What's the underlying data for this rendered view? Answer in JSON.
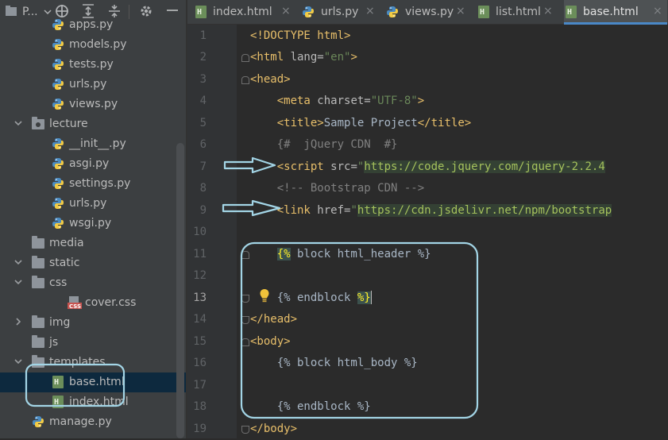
{
  "sidebar": {
    "title": "P...",
    "toolbar_icons": [
      "crosshair-icon",
      "expand-all-icon",
      "collapse-all-icon",
      "gear-icon",
      "minimize-icon"
    ],
    "tree": [
      {
        "label": "apps.py",
        "type": "py",
        "depth": 3
      },
      {
        "label": "models.py",
        "type": "py",
        "depth": 3
      },
      {
        "label": "tests.py",
        "type": "py",
        "depth": 3
      },
      {
        "label": "urls.py",
        "type": "py",
        "depth": 3
      },
      {
        "label": "views.py",
        "type": "py",
        "depth": 3
      },
      {
        "label": "lecture",
        "type": "package",
        "depth": 1,
        "expanded": true
      },
      {
        "label": "__init__.py",
        "type": "py",
        "depth": 3
      },
      {
        "label": "asgi.py",
        "type": "py",
        "depth": 3
      },
      {
        "label": "settings.py",
        "type": "py",
        "depth": 3
      },
      {
        "label": "urls.py",
        "type": "py",
        "depth": 3
      },
      {
        "label": "wsgi.py",
        "type": "py",
        "depth": 3
      },
      {
        "label": "media",
        "type": "folder",
        "depth": 2
      },
      {
        "label": "static",
        "type": "folder",
        "depth": 1,
        "expanded": true
      },
      {
        "label": "css",
        "type": "folder",
        "depth": 2,
        "expanded": true
      },
      {
        "label": "cover.css",
        "type": "css",
        "depth": 4
      },
      {
        "label": "img",
        "type": "folder",
        "depth": 2,
        "expanded": false
      },
      {
        "label": "js",
        "type": "folder",
        "depth": 2
      },
      {
        "label": "templates",
        "type": "folder",
        "depth": 1,
        "expanded": true
      },
      {
        "label": "base.html",
        "type": "html",
        "depth": 3,
        "selected": true
      },
      {
        "label": "index.html",
        "type": "html",
        "depth": 3
      },
      {
        "label": "manage.py",
        "type": "py",
        "depth": 2
      }
    ]
  },
  "tabs": [
    {
      "label": "index.html",
      "type": "html",
      "active": false
    },
    {
      "label": "urls.py",
      "type": "py",
      "active": false
    },
    {
      "label": "views.py",
      "type": "py",
      "active": false
    },
    {
      "label": "list.html",
      "type": "html",
      "active": false
    },
    {
      "label": "base.html",
      "type": "html",
      "active": true
    }
  ],
  "editor": {
    "current_line": 13,
    "line_numbers": [
      "1",
      "2",
      "3",
      "4",
      "5",
      "6",
      "7",
      "8",
      "9",
      "10",
      "11",
      "12",
      "13",
      "14",
      "15",
      "16",
      "17",
      "18",
      "19"
    ],
    "lines": [
      [
        {
          "t": "<!DOCTYPE html>",
          "c": "tag"
        }
      ],
      [
        {
          "t": "<html ",
          "c": "tag"
        },
        {
          "t": "lang=",
          "c": "attr"
        },
        {
          "t": "\"en\"",
          "c": "str"
        },
        {
          "t": ">",
          "c": "tag"
        }
      ],
      [
        {
          "t": "<head>",
          "c": "tag"
        }
      ],
      [
        {
          "t": "    "
        },
        {
          "t": "<meta ",
          "c": "tag"
        },
        {
          "t": "charset=",
          "c": "attr"
        },
        {
          "t": "\"UTF-8\"",
          "c": "str"
        },
        {
          "t": ">",
          "c": "tag"
        }
      ],
      [
        {
          "t": "    "
        },
        {
          "t": "<title>",
          "c": "tag"
        },
        {
          "t": "Sample Project",
          "c": "plain"
        },
        {
          "t": "</title>",
          "c": "tag"
        }
      ],
      [
        {
          "t": "    "
        },
        {
          "t": "{#  jQuery CDN  #}",
          "c": "cmt"
        }
      ],
      [
        {
          "t": "    "
        },
        {
          "t": "<script ",
          "c": "tag"
        },
        {
          "t": "src=",
          "c": "attr"
        },
        {
          "t": "\"",
          "c": "str"
        },
        {
          "t": "https://code.jquery.com/jquery-2.2.4",
          "c": "url"
        }
      ],
      [
        {
          "t": "    "
        },
        {
          "t": "<!-- Bootstrap CDN -->",
          "c": "cmt"
        }
      ],
      [
        {
          "t": "    "
        },
        {
          "t": "<link ",
          "c": "tag"
        },
        {
          "t": "href=",
          "c": "attr"
        },
        {
          "t": "\"",
          "c": "str"
        },
        {
          "t": "https://cdn.jsdelivr.net/npm/bootstrap",
          "c": "url"
        }
      ],
      [],
      [
        {
          "t": "    "
        },
        {
          "t": "{%",
          "c": "tpl-hl"
        },
        {
          "t": " block html_header %}",
          "c": "tpl"
        }
      ],
      [],
      [
        {
          "t": "    "
        },
        {
          "t": "{% endblock ",
          "c": "tpl"
        },
        {
          "t": "%}",
          "c": "tpl-hl"
        },
        {
          "t": "",
          "c": "caret"
        }
      ],
      [
        {
          "t": "</head>",
          "c": "tag"
        }
      ],
      [
        {
          "t": "<body>",
          "c": "tag"
        }
      ],
      [
        {
          "t": "    "
        },
        {
          "t": "{% block html_body %}",
          "c": "tpl"
        }
      ],
      [],
      [
        {
          "t": "    "
        },
        {
          "t": "{% endblock %}",
          "c": "tpl"
        }
      ],
      [
        {
          "t": "</body>",
          "c": "tag"
        }
      ]
    ]
  },
  "colors": {
    "annotation": "#a3d5e6",
    "selection": "#0d293e",
    "tab_accent": "#4a88c7"
  }
}
